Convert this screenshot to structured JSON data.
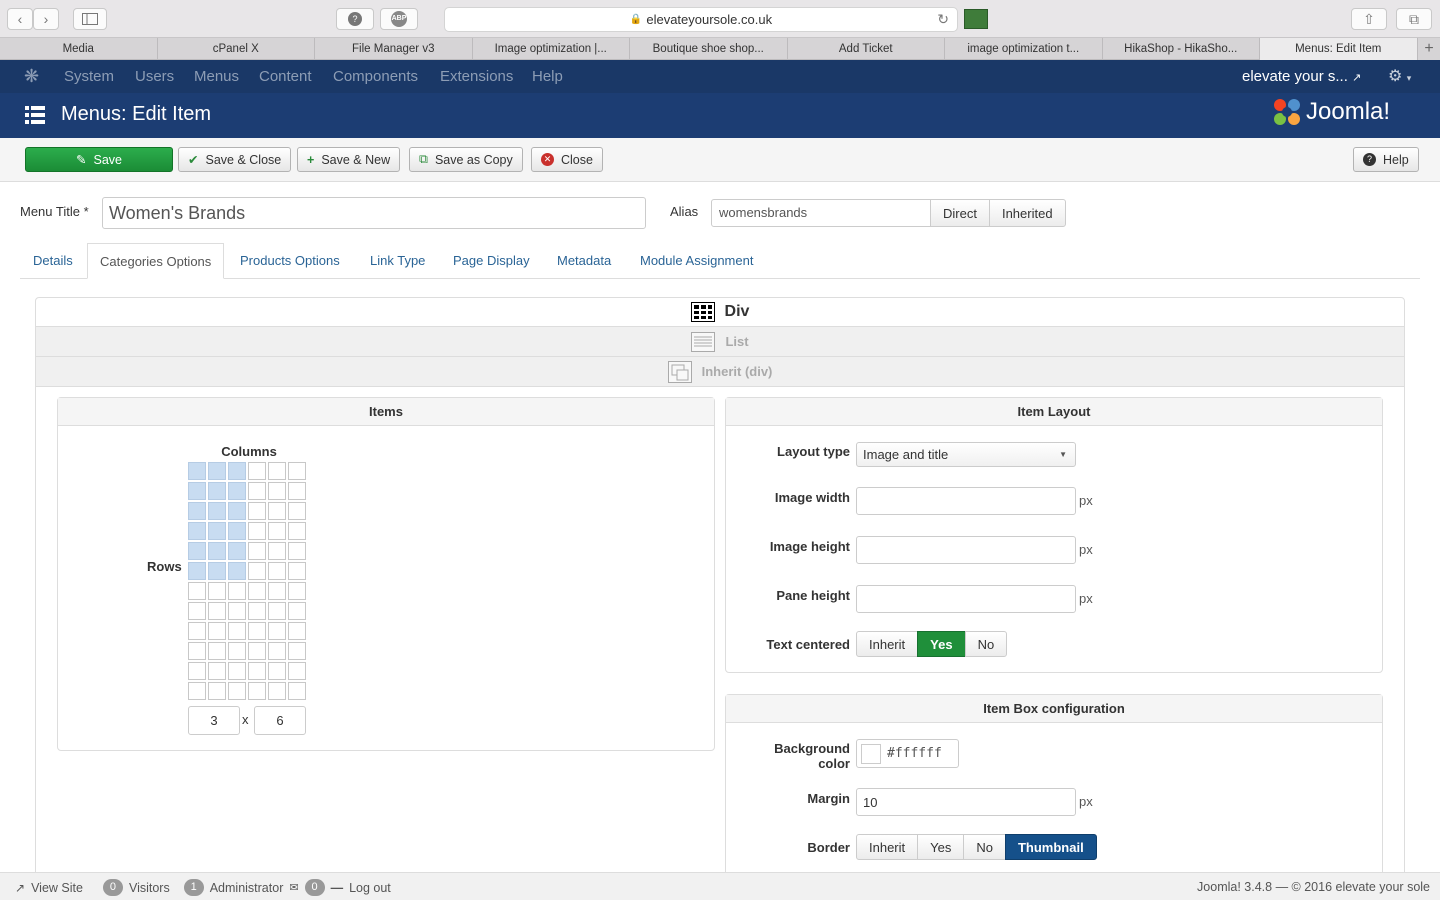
{
  "browser": {
    "url": "elevateyoursole.co.uk",
    "tabs": [
      "Media",
      "cPanel X",
      "File Manager v3",
      "Image optimization |...",
      "Boutique shoe shop...",
      "Add Ticket",
      "image optimization t...",
      "HikaShop - HikaSho...",
      "Menus: Edit Item"
    ],
    "active_tab": 8
  },
  "nav": {
    "items": [
      "System",
      "Users",
      "Menus",
      "Content",
      "Components",
      "Extensions",
      "Help"
    ],
    "site_name": "elevate your s..."
  },
  "header": {
    "title": "Menus: Edit Item",
    "brand": "Joomla!"
  },
  "toolbar": {
    "save": "Save",
    "save_close": "Save & Close",
    "save_new": "Save & New",
    "save_copy": "Save as Copy",
    "close": "Close",
    "help": "Help"
  },
  "form": {
    "menu_title_label": "Menu Title *",
    "menu_title_value": "Women's Brands",
    "alias_label": "Alias",
    "alias_value": "womensbrands",
    "alias_direct": "Direct",
    "alias_inherited": "Inherited"
  },
  "tabs": [
    "Details",
    "Categories Options",
    "Products Options",
    "Link Type",
    "Page Display",
    "Metadata",
    "Module Assignment"
  ],
  "layout_options": {
    "div": "Div",
    "list": "List",
    "inherit": "Inherit (div)"
  },
  "items_panel": {
    "title": "Items",
    "columns_label": "Columns",
    "rows_label": "Rows",
    "columns_value": "3",
    "rows_value": "6",
    "separator": "x",
    "grid_columns": 6,
    "grid_rows": 12
  },
  "item_layout": {
    "title": "Item Layout",
    "layout_type_label": "Layout type",
    "layout_type_value": "Image and title",
    "image_width_label": "Image width",
    "image_height_label": "Image height",
    "pane_height_label": "Pane height",
    "unit": "px",
    "text_centered_label": "Text centered",
    "text_centered_options": [
      "Inherit",
      "Yes",
      "No"
    ],
    "text_centered_selected": "Yes"
  },
  "item_box": {
    "title": "Item Box configuration",
    "bg_color_label": "Background color",
    "bg_color_value": "#ffffff",
    "margin_label": "Margin",
    "margin_value": "10",
    "unit": "px",
    "border_label": "Border",
    "border_options": [
      "Inherit",
      "Yes",
      "No",
      "Thumbnail"
    ],
    "border_selected": "Thumbnail"
  },
  "status": {
    "view_site": "View Site",
    "visitors_count": "0",
    "visitors_label": "Visitors",
    "admin_count": "1",
    "admin_label": "Administrator",
    "messages_count": "0",
    "logout": "Log out",
    "footer": "Joomla! 3.4.8  —  © 2016 elevate your sole"
  },
  "colors": {
    "navbar": "#1a3867",
    "header": "#1c3d73",
    "save_green": "#1f8f3a",
    "thumbnail_blue": "#15508a"
  }
}
